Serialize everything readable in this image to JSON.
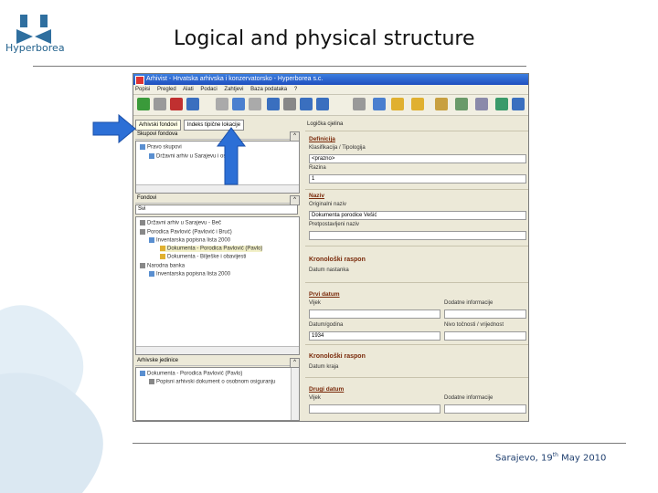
{
  "slide": {
    "title": "Logical and physical structure",
    "logo_text": "Hyperborea",
    "footer_text": "Sarajevo, 19",
    "footer_sup": "th",
    "footer_rest": " May 2010"
  },
  "app": {
    "window_title": "Arhivist - Hrvatska arhivska i konzervatorsko - Hyperborea s.c.",
    "menu": [
      "Popisi",
      "Pregled",
      "Alati",
      "Podaci",
      "Zahtjevi",
      "Baza podataka",
      "?"
    ],
    "tabs": [
      "Arhivski fondovi",
      "Indeks tipične lokacije"
    ],
    "left_top": {
      "header": "Skupovi fondova",
      "items": [
        "Pravo skupovi",
        "Državni arhiv u Sarajevu i ostali"
      ]
    },
    "left_mid": {
      "header": "Fondovi",
      "combo_value": "Svi",
      "items": [
        "Državni arhiv u Sarajevu - Beč",
        "Porodica Pavlović (Pavlović i Bruć)",
        "Inventarska popisna lista 2000",
        "Dokumenta - Porodica Pavlović (Pavlo)",
        "Dokumenta - Bilješke i obavijesti",
        "Narodna banka",
        "Inventarska popisna lista 2000"
      ]
    },
    "left_bottom": {
      "header": "Arhivske jedinice",
      "items": [
        "Dokumenta - Porodica Pavlović (Pavlo)",
        "Popisni arhivski dokument o osobnom osiguranju"
      ]
    },
    "right": {
      "header": "Logička cjelina",
      "sec_definition": "Definicija",
      "label_klasifikacija": "Klasifikacija / Tipologija",
      "field_klasifikacija": "<prazno>",
      "label_broj": "Razina",
      "field_broj": "1",
      "sec_naziv": "Naziv",
      "label_originalni": "Originalni naziv",
      "field_originalni": "Dokumenta porodice Vešić",
      "label_pretpostavljeni": "Pretpostavljeni naziv",
      "sec_kronoloski": "Kronološki raspon",
      "label_datum_nastanka": "Datum nastanka",
      "sub_prvi_datum": "Prvi datum",
      "label_vijek": "Vijek",
      "label_dodatne": "Dodatne informacije",
      "label_datum_godina": "Datum/godina",
      "label_nivo": "Nivo točnosti / vrijednost",
      "field_datum": "1934",
      "sec_kronoloski2": "Kronološki raspon",
      "label_kraj": "Datum kraja",
      "sub_drugi": "Drugi datum",
      "label_vijek2": "Vijek",
      "label_dodatne2": "Dodatne informacije"
    }
  },
  "colors": {
    "brand_blue": "#1f5f8b",
    "deco_blue": "#d6e6f2",
    "arrow_blue": "#2c6fd6"
  },
  "icons": [
    "hyperborea-logo-icon",
    "arrow-right-icon",
    "arrow-up-icon"
  ]
}
